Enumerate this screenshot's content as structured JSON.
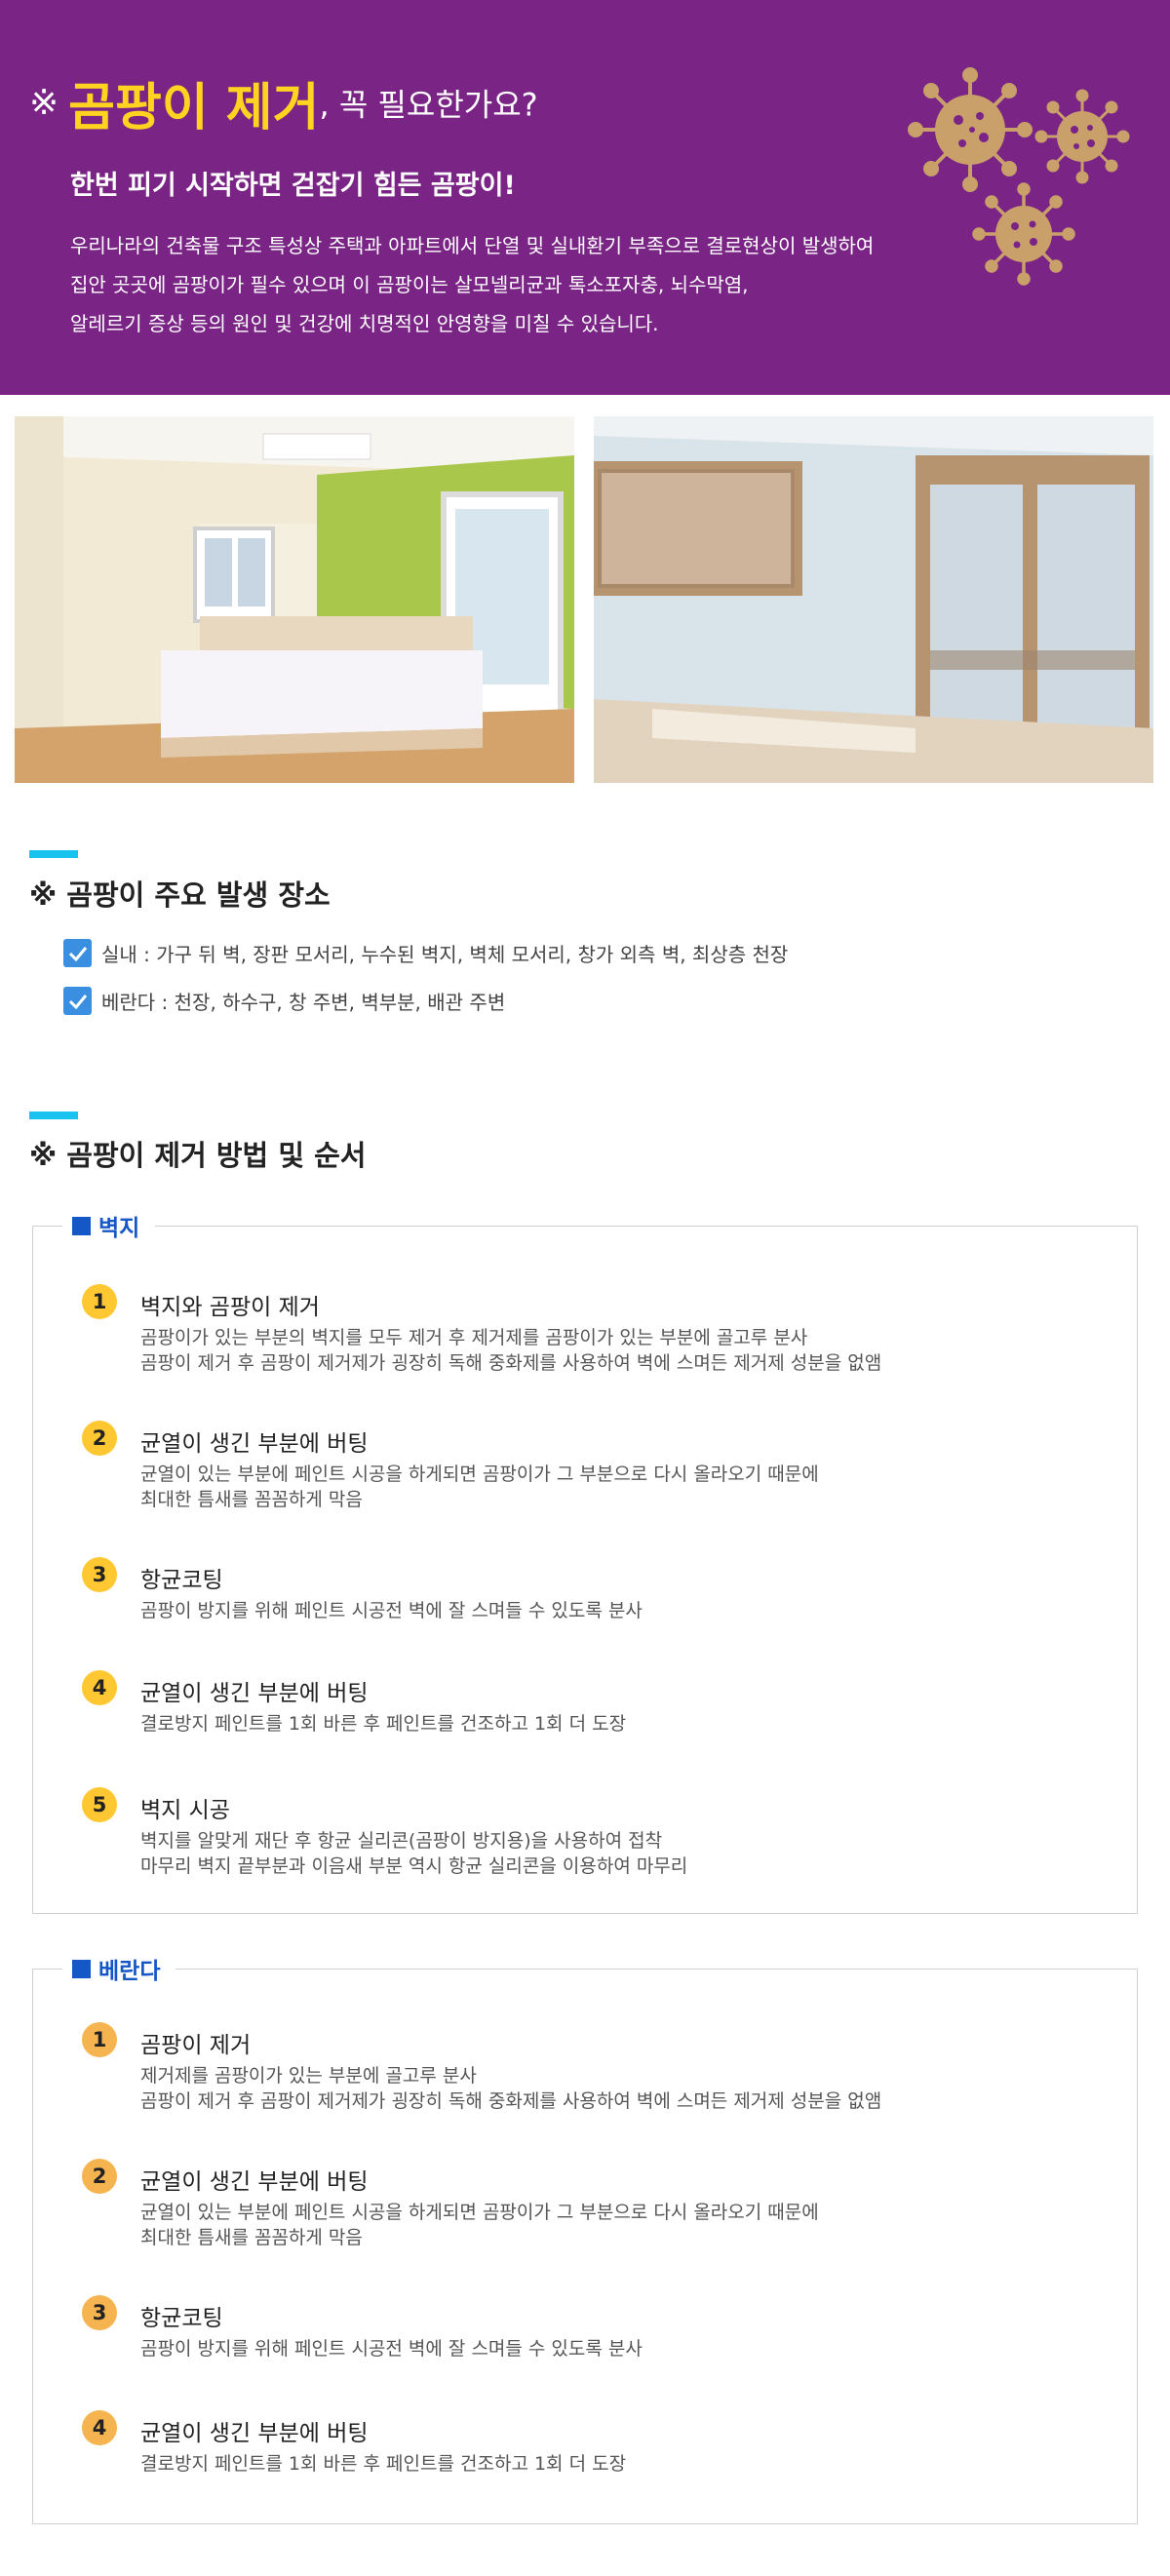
{
  "hero": {
    "mark": "※",
    "highlight": "곰팡이 제거",
    "title_rest": ", 꼭 필요한가요?",
    "subtitle": "한번 피기 시작하면 걷잡기 힘든 곰팡이!",
    "body": [
      "우리나라의 건축물 구조 특성상 주택과 아파트에서 단열 및 실내환기 부족으로 결로현상이 발생하여",
      "집안 곳곳에 곰팡이가 필수 있으며 이 곰팡이는 살모넬리균과 톡소포자충, 뇌수막염,",
      "알레르기 증상 등의 원인 및 건강에 치명적인 안영향을 미칠 수 있습니다."
    ],
    "colors": {
      "background": "#7a2586",
      "highlight": "#ffd320",
      "virus": "#c9a06a"
    }
  },
  "locations": {
    "title": "※ 곰팡이 주요 발생 장소",
    "items": [
      "실내 : 가구 뒤 벽, 장판 모서리, 누수된 벽지, 벽체 모서리, 창가 외측 벽, 최상층 천장",
      "베란다 : 천장, 하수구, 창 주변, 벽부분, 배관 주변"
    ]
  },
  "methods": {
    "title": "※ 곰팡이 제거 방법 및 순서",
    "wall": {
      "label": "벽지",
      "steps": [
        {
          "num": "1",
          "title": "벽지와 곰팡이 제거",
          "desc": [
            "곰팡이가 있는 부분의 벽지를 모두 제거 후 제거제를 곰팡이가 있는 부분에 골고루 분사",
            "곰팡이 제거 후 곰팡이 제거제가 굉장히 독해 중화제를 사용하여 벽에 스며든 제거제 성분을 없앰"
          ]
        },
        {
          "num": "2",
          "title": "균열이 생긴 부분에 버팅",
          "desc": [
            "균열이 있는 부분에 페인트 시공을 하게되면 곰팡이가 그 부분으로 다시 올라오기 때문에",
            "최대한 틈새를 꼼꼼하게 막음"
          ]
        },
        {
          "num": "3",
          "title": "항균코팅",
          "desc": [
            "곰팡이 방지를 위해 페인트 시공전 벽에 잘 스며들 수 있도록 분사"
          ]
        },
        {
          "num": "4",
          "title": "균열이 생긴 부분에 버팅",
          "desc": [
            "결로방지 페인트를 1회 바른 후 페인트를 건조하고 1회 더 도장"
          ]
        },
        {
          "num": "5",
          "title": "벽지 시공",
          "desc": [
            "벽지를 알맞게 재단 후 항균 실리콘(곰팡이 방지용)을 사용하여 접착",
            "마무리 벽지 끝부분과 이음새 부분 역시 항균 실리콘을 이용하여 마무리"
          ]
        }
      ]
    },
    "veranda": {
      "label": "베란다",
      "steps": [
        {
          "num": "1",
          "title": "곰팡이 제거",
          "desc": [
            "제거제를 곰팡이가 있는 부분에 골고루 분사",
            "곰팡이 제거 후 곰팡이 제거제가 굉장히 독해 중화제를 사용하여 벽에 스며든 제거제 성분을 없앰"
          ]
        },
        {
          "num": "2",
          "title": "균열이 생긴 부분에 버팅",
          "desc": [
            "균열이 있는 부분에 페인트 시공을 하게되면 곰팡이가 그 부분으로 다시 올라오기 때문에",
            "최대한 틈새를 꼼꼼하게 막음"
          ]
        },
        {
          "num": "3",
          "title": "항균코팅",
          "desc": [
            "곰팡이 방지를 위해 페인트 시공전 벽에 잘 스며들 수 있도록 분사"
          ]
        },
        {
          "num": "4",
          "title": "균열이 생긴 부분에 버팅",
          "desc": [
            "결로방지 페인트를 1회 바른 후 페인트를 건조하고 1회 더 도장"
          ]
        }
      ]
    }
  }
}
